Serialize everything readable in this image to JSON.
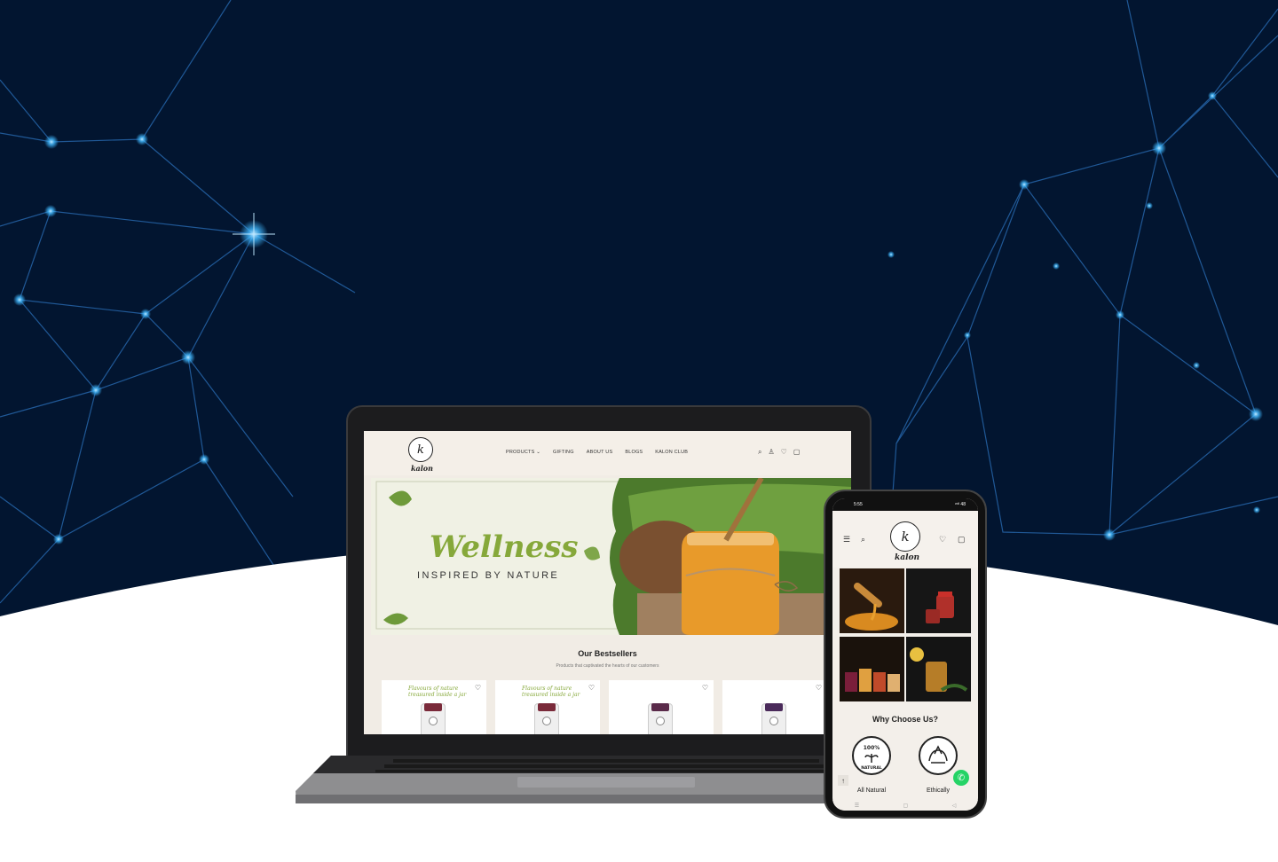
{
  "laptop_site": {
    "brand": "kalon",
    "logo_letter": "k",
    "nav": [
      "PRODUCTS ⌄",
      "GIFTING",
      "ABOUT US",
      "BLOGS",
      "KALON CLUB"
    ],
    "header_icons": [
      "search-icon",
      "account-icon",
      "wishlist-icon",
      "cart-icon"
    ],
    "hero_title": "Wellness",
    "hero_subtitle": "INSPIRED BY NATURE",
    "bestsellers_title": "Our Bestsellers",
    "bestsellers_subtitle": "Products that captivated the hearts of our customers",
    "card_tagline": "Flavours of nature treasured inside a jar"
  },
  "phone_site": {
    "status_time": "5:55",
    "status_signal": "ᵛᵒˡˡ 48",
    "brand": "kalon",
    "logo_letter": "k",
    "why_title": "Why Choose Us?",
    "badges": [
      "All Natural",
      "Ethically"
    ],
    "badge1_text": "100% NATURAL"
  },
  "colors": {
    "background_dark": "#021530",
    "network_glow": "#3fb8ff",
    "brand_green": "#86a83a",
    "site_bg": "#f1ece5"
  }
}
